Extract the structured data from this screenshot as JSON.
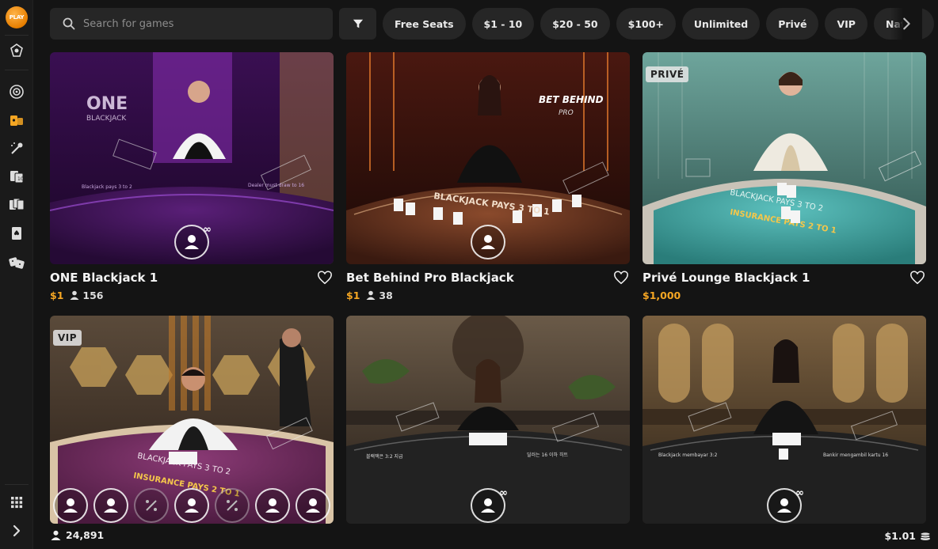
{
  "brand": {
    "logo_text": "PLAY"
  },
  "sidebar": {
    "icons": [
      "lobby-icon",
      "roulette-icon",
      "game-shows-icon",
      "dice-icon",
      "baccarat-icon",
      "blackjack-cards-icon",
      "blackjack-icon",
      "sic-bo-icon"
    ],
    "bottom_icons": [
      "grid-menu-icon",
      "expand-arrow-icon"
    ]
  },
  "search": {
    "placeholder": "Search for games"
  },
  "filters": [
    "Free Seats",
    "$1 - 10",
    "$20 - 50",
    "$100+",
    "Unlimited",
    "Privé",
    "VIP",
    "Native"
  ],
  "games": [
    {
      "title": "ONE Blackjack 1",
      "price": "$1",
      "players": "156",
      "badge": ""
    },
    {
      "title": "Bet Behind Pro Blackjack",
      "price": "$1",
      "players": "38",
      "badge": ""
    },
    {
      "title": "Privé Lounge Blackjack 1",
      "price": "$1,000",
      "players": "",
      "badge": "PRIVÉ"
    },
    {
      "title": "",
      "price": "",
      "players": "",
      "badge": "VIP"
    },
    {
      "title": "",
      "price": "",
      "players": "",
      "badge": ""
    },
    {
      "title": "",
      "price": "",
      "players": "",
      "badge": ""
    }
  ],
  "footer": {
    "online_count": "24,891",
    "balance": "$1.01"
  },
  "colors": {
    "accent": "#f5a623",
    "background": "#141414",
    "chip": "#262626"
  }
}
